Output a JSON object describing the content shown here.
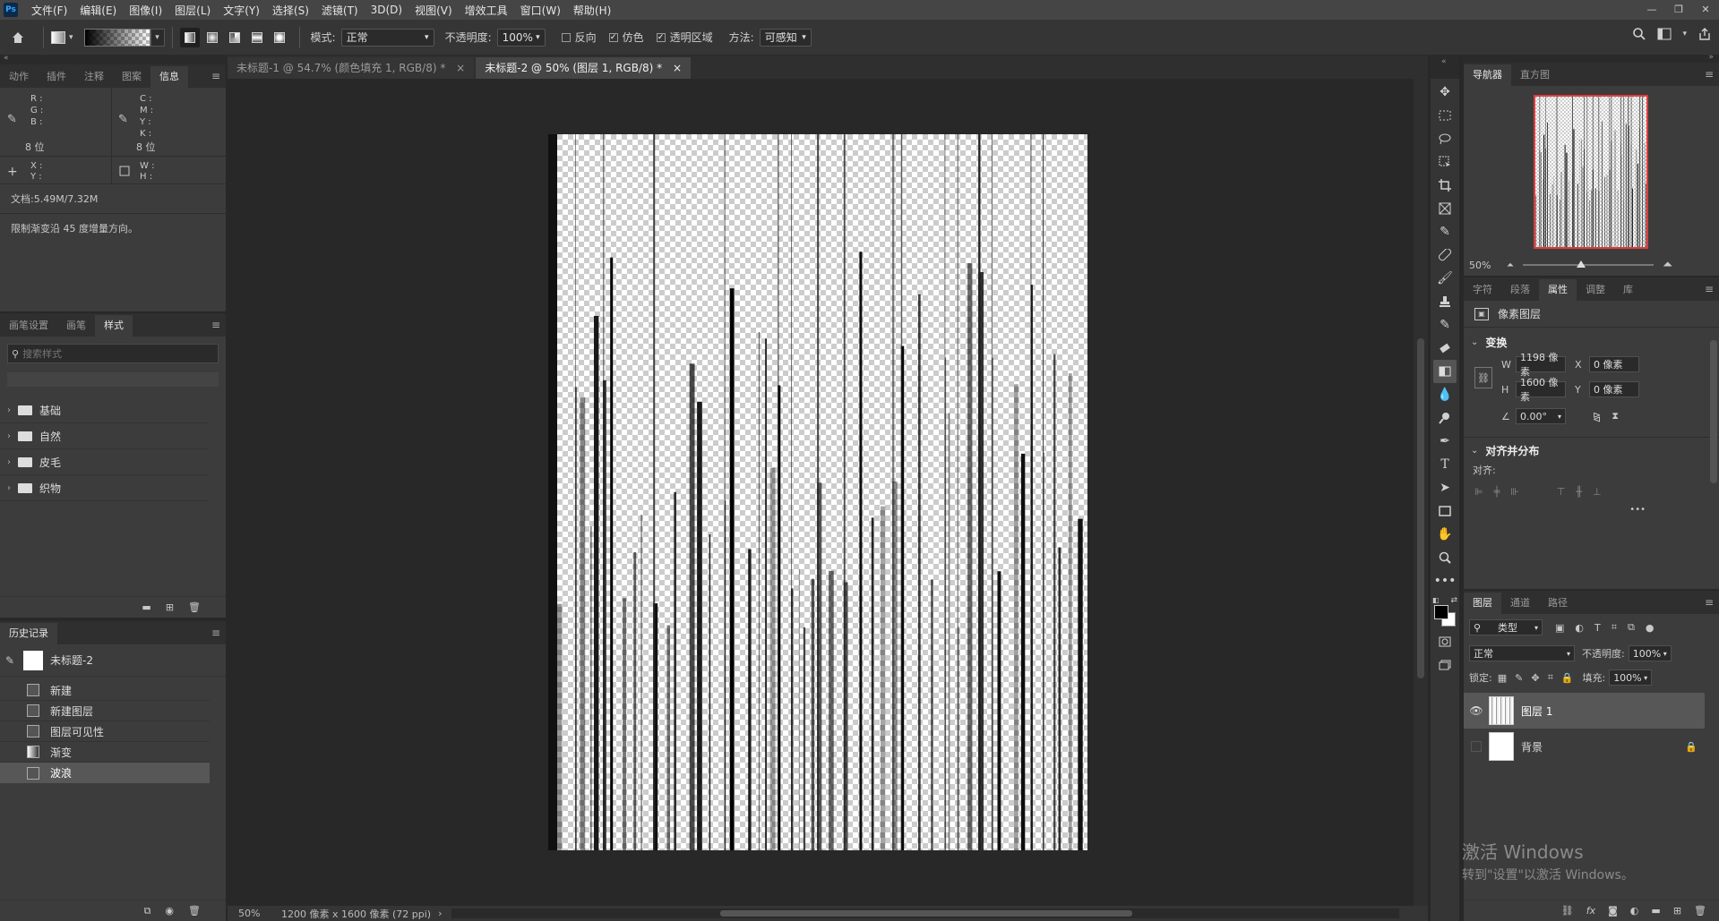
{
  "menubar": {
    "app_logo": "Ps",
    "items": [
      "文件(F)",
      "编辑(E)",
      "图像(I)",
      "图层(L)",
      "文字(Y)",
      "选择(S)",
      "滤镜(T)",
      "3D(D)",
      "视图(V)",
      "增效工具",
      "窗口(W)",
      "帮助(H)"
    ]
  },
  "options": {
    "mode_label": "模式:",
    "mode_value": "正常",
    "opacity_label": "不透明度:",
    "opacity_value": "100%",
    "reverse_label": "反向",
    "dither_label": "仿色",
    "transparency_label": "透明区域",
    "method_label": "方法:",
    "method_value": "可感知"
  },
  "info_panel": {
    "tabs": [
      "动作",
      "插件",
      "注释",
      "图案",
      "信息"
    ],
    "rgb_labels": [
      "R :",
      "G :",
      "B :"
    ],
    "cmyk_labels": [
      "C :",
      "M :",
      "Y :",
      "K :"
    ],
    "bits_left": "8 位",
    "bits_right": "8 位",
    "xy_labels": [
      "X :",
      "Y :"
    ],
    "wh_labels": [
      "W :",
      "H :"
    ],
    "doc_size": "文档:5.49M/7.32M",
    "hint": "限制渐变沿 45 度增量方向。"
  },
  "styles_panel": {
    "tabs": [
      "画笔设置",
      "画笔",
      "样式"
    ],
    "search_placeholder": "搜索样式",
    "groups": [
      "基础",
      "自然",
      "皮毛",
      "织物"
    ]
  },
  "history_panel": {
    "tab": "历史记录",
    "snapshot": "未标题-2",
    "items": [
      "新建",
      "新建图层",
      "图层可见性",
      "渐变",
      "波浪"
    ]
  },
  "doc_tabs": [
    {
      "label": "未标题-1 @ 54.7% (颜色填充 1, RGB/8) *"
    },
    {
      "label": "未标题-2 @ 50% (图层 1, RGB/8) *"
    }
  ],
  "status": {
    "zoom": "50%",
    "doc_info": "1200 像素 x 1600 像素 (72 ppi)"
  },
  "navigator": {
    "tabs": [
      "导航器",
      "直方图"
    ],
    "zoom": "50%"
  },
  "properties": {
    "tabs": [
      "字符",
      "段落",
      "属性",
      "调整",
      "库"
    ],
    "layer_type": "像素图层",
    "transform_title": "变换",
    "w_label": "W",
    "w_value": "1198 像素",
    "h_label": "H",
    "h_value": "1600 像素",
    "x_label": "X",
    "x_value": "0 像素",
    "y_label": "Y",
    "y_value": "0 像素",
    "angle_value": "0.00°",
    "align_title": "对齐并分布",
    "align_label": "对齐:",
    "more": "•••"
  },
  "layers": {
    "tabs": [
      "图层",
      "通道",
      "路径"
    ],
    "filter_value": "类型",
    "blend_value": "正常",
    "opacity_label": "不透明度:",
    "opacity_value": "100%",
    "lock_label": "锁定:",
    "fill_label": "填充:",
    "fill_value": "100%",
    "items": [
      {
        "name": "图层 1"
      },
      {
        "name": "背景"
      }
    ]
  },
  "watermark": {
    "line1": "激活 Windows",
    "line2": "转到\"设置\"以激活 Windows。"
  },
  "colors": {
    "accent_red": "#e03c3c",
    "panel_bg": "#3c3c3c",
    "canvas_bg": "#282828"
  }
}
